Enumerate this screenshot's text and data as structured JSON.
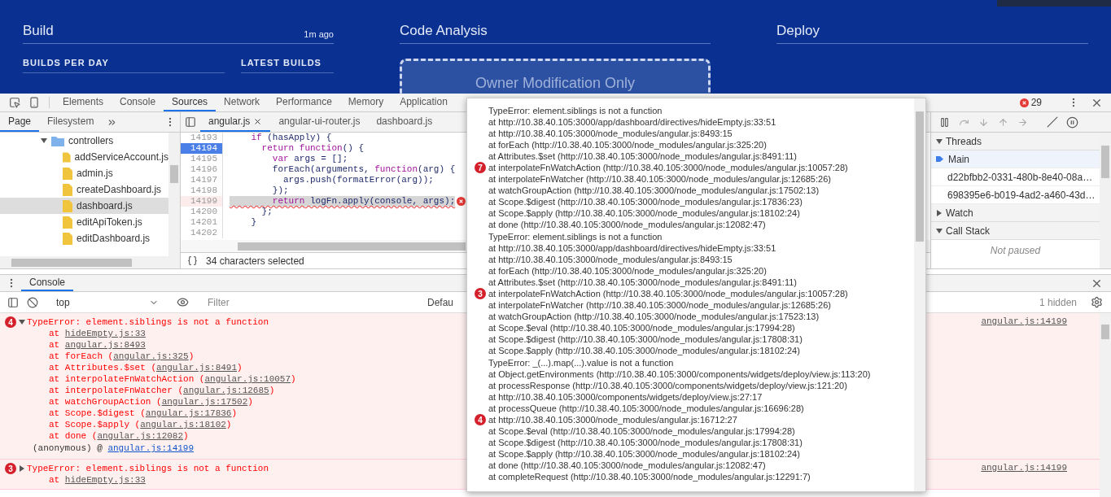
{
  "banner": {
    "sections": [
      {
        "title": "Build",
        "time": "1m ago",
        "subheaders": [
          "BUILDS PER DAY",
          "LATEST BUILDS"
        ]
      },
      {
        "title": "Code Analysis",
        "notice": "Owner Modification Only"
      },
      {
        "title": "Deploy"
      }
    ]
  },
  "devtools": {
    "tabs": [
      {
        "label": "Elements",
        "selected": false
      },
      {
        "label": "Console",
        "selected": false
      },
      {
        "label": "Sources",
        "selected": true
      },
      {
        "label": "Network",
        "selected": false
      },
      {
        "label": "Performance",
        "selected": false
      },
      {
        "label": "Memory",
        "selected": false
      },
      {
        "label": "Application",
        "selected": false
      }
    ],
    "error_count": "29",
    "navigator": {
      "tabs": [
        {
          "label": "Page",
          "selected": true
        },
        {
          "label": "Filesystem",
          "selected": false
        }
      ],
      "tree": [
        {
          "name": "controllers",
          "kind": "folder",
          "expanded": true,
          "children": [
            {
              "name": "addServiceAccount.js",
              "kind": "file",
              "selected": false
            },
            {
              "name": "admin.js",
              "kind": "file",
              "selected": false
            },
            {
              "name": "createDashboard.js",
              "kind": "file",
              "selected": false
            },
            {
              "name": "dashboard.js",
              "kind": "file",
              "selected": true
            },
            {
              "name": "editApiToken.js",
              "kind": "file",
              "selected": false
            },
            {
              "name": "editDashboard.js",
              "kind": "file",
              "selected": false
            }
          ]
        }
      ]
    },
    "editor": {
      "tabs": [
        {
          "label": "angular.js",
          "selected": true
        },
        {
          "label": "angular-ui-router.js",
          "selected": false
        },
        {
          "label": "dashboard.js",
          "selected": false
        }
      ],
      "lines": [
        {
          "number": "14193",
          "tokens": [
            {
              "keyword": true,
              "t": "    if"
            },
            {
              "keyword": false,
              "t": " (hasApply) {"
            }
          ]
        },
        {
          "number": "14194",
          "breakpoint": true,
          "tokens": [
            {
              "keyword": true,
              "t": "      return function"
            },
            {
              "keyword": false,
              "t": "() {"
            }
          ]
        },
        {
          "number": "14195",
          "tokens": [
            {
              "keyword": true,
              "t": "        var"
            },
            {
              "keyword": false,
              "t": " args = [];"
            }
          ]
        },
        {
          "number": "14196",
          "tokens": [
            {
              "keyword": false,
              "t": "        forEach(arguments, "
            },
            {
              "keyword": true,
              "t": "function"
            },
            {
              "keyword": false,
              "t": "(arg) {"
            }
          ]
        },
        {
          "number": "14197",
          "tokens": [
            {
              "keyword": false,
              "t": "          args.push(formatError(arg));"
            }
          ]
        },
        {
          "number": "14198",
          "tokens": [
            {
              "keyword": false,
              "t": "        });"
            }
          ]
        },
        {
          "number": "14199",
          "error": true,
          "selected": true,
          "tokens": [
            {
              "keyword": true,
              "t": "        return"
            },
            {
              "keyword": false,
              "t": " logFn.apply(console, args);"
            }
          ]
        },
        {
          "number": "14200",
          "tokens": [
            {
              "keyword": false,
              "t": "      };"
            }
          ]
        },
        {
          "number": "14201",
          "tokens": [
            {
              "keyword": false,
              "t": "    }"
            }
          ]
        },
        {
          "number": "14202"
        }
      ],
      "status": "34 characters selected"
    },
    "debugger": {
      "sections": [
        {
          "title": "Threads",
          "expanded": true,
          "items": [
            {
              "label": "Main",
              "selected": true
            },
            {
              "label": "d22bfbb2-0331-480b-8e40-08a…",
              "selected": false
            },
            {
              "label": "698395e6-b019-4ad2-a460-43d…",
              "selected": false
            }
          ]
        },
        {
          "title": "Watch",
          "expanded": false
        },
        {
          "title": "Call Stack",
          "expanded": true,
          "empty_text": "Not paused"
        }
      ]
    },
    "drawer": {
      "tabs": [
        {
          "label": "Console",
          "selected": true
        }
      ]
    },
    "console_toolbar": {
      "context": "top",
      "filter_placeholder": "Filter",
      "levels": "Defau",
      "hidden_count": "1 hidden"
    },
    "messages": [
      {
        "count": "4",
        "expanded": true,
        "text": "TypeError: element.siblings is not a function",
        "source": "angular.js:14199",
        "stack": [
          {
            "prefix": "at ",
            "link": "hideEmpty.js:33"
          },
          {
            "prefix": "at ",
            "link": "angular.js:8493"
          },
          {
            "prefix": "at forEach (",
            "link": "angular.js:325",
            "suffix": ")"
          },
          {
            "prefix": "at Attributes.$set (",
            "link": "angular.js:8491",
            "suffix": ")"
          },
          {
            "prefix": "at interpolateFnWatchAction (",
            "link": "angular.js:10057",
            "suffix": ")"
          },
          {
            "prefix": "at interpolateFnWatcher (",
            "link": "angular.js:12685",
            "suffix": ")"
          },
          {
            "prefix": "at watchGroupAction (",
            "link": "angular.js:17502",
            "suffix": ")"
          },
          {
            "prefix": "at Scope.$digest (",
            "link": "angular.js:17836",
            "suffix": ")"
          },
          {
            "prefix": "at Scope.$apply (",
            "link": "angular.js:18102",
            "suffix": ")"
          },
          {
            "prefix": "at done (",
            "link": "angular.js:12082",
            "suffix": ")"
          }
        ],
        "origin": {
          "prefix": "(anonymous) @ ",
          "link": "angular.js:14199"
        }
      },
      {
        "count": "3",
        "expanded": false,
        "text": "TypeError: element.siblings is not a function",
        "source": "angular.js:14199",
        "stack": [
          {
            "prefix": "at ",
            "link": "hideEmpty.js:33"
          }
        ]
      }
    ]
  },
  "tooltip": {
    "groups": [
      {
        "lines": [
          {
            "text": "TypeError: element.siblings is not a function"
          },
          {
            "text": "at http://10.38.40.105:3000/app/dashboard/directives/hideEmpty.js:33:51"
          },
          {
            "text": "at http://10.38.40.105:3000/node_modules/angular.js:8493:15"
          },
          {
            "text": "at forEach (http://10.38.40.105:3000/node_modules/angular.js:325:20)"
          },
          {
            "text": "at Attributes.$set (http://10.38.40.105:3000/node_modules/angular.js:8491:11)"
          },
          {
            "text": "at interpolateFnWatchAction (http://10.38.40.105:3000/node_modules/angular.js:10057:28)",
            "count": "7"
          },
          {
            "text": "at interpolateFnWatcher (http://10.38.40.105:3000/node_modules/angular.js:12685:26)"
          },
          {
            "text": "at watchGroupAction (http://10.38.40.105:3000/node_modules/angular.js:17502:13)"
          },
          {
            "text": "at Scope.$digest (http://10.38.40.105:3000/node_modules/angular.js:17836:23)"
          },
          {
            "text": "at Scope.$apply (http://10.38.40.105:3000/node_modules/angular.js:18102:24)"
          },
          {
            "text": "at done (http://10.38.40.105:3000/node_modules/angular.js:12082:47)"
          }
        ]
      },
      {
        "lines": [
          {
            "text": "TypeError: element.siblings is not a function"
          },
          {
            "text": "at http://10.38.40.105:3000/app/dashboard/directives/hideEmpty.js:33:51"
          },
          {
            "text": "at http://10.38.40.105:3000/node_modules/angular.js:8493:15"
          },
          {
            "text": "at forEach (http://10.38.40.105:3000/node_modules/angular.js:325:20)"
          },
          {
            "text": "at Attributes.$set (http://10.38.40.105:3000/node_modules/angular.js:8491:11)"
          },
          {
            "text": "at interpolateFnWatchAction (http://10.38.40.105:3000/node_modules/angular.js:10057:28)",
            "count": "3"
          },
          {
            "text": "at interpolateFnWatcher (http://10.38.40.105:3000/node_modules/angular.js:12685:26)"
          },
          {
            "text": "at watchGroupAction (http://10.38.40.105:3000/node_modules/angular.js:17523:13)"
          },
          {
            "text": "at Scope.$eval (http://10.38.40.105:3000/node_modules/angular.js:17994:28)"
          },
          {
            "text": "at Scope.$digest (http://10.38.40.105:3000/node_modules/angular.js:17808:31)"
          },
          {
            "text": "at Scope.$apply (http://10.38.40.105:3000/node_modules/angular.js:18102:24)"
          }
        ]
      },
      {
        "lines": [
          {
            "text": "TypeError: _(...).map(...).value is not a function"
          },
          {
            "text": "at Object.getEnvironments (http://10.38.40.105:3000/components/widgets/deploy/view.js:113:20)"
          },
          {
            "text": "at processResponse (http://10.38.40.105:3000/components/widgets/deploy/view.js:121:20)"
          },
          {
            "text": "at http://10.38.40.105:3000/components/widgets/deploy/view.js:27:17"
          },
          {
            "text": "at processQueue (http://10.38.40.105:3000/node_modules/angular.js:16696:28)"
          },
          {
            "text": "at http://10.38.40.105:3000/node_modules/angular.js:16712:27",
            "count": "4"
          },
          {
            "text": "at Scope.$eval (http://10.38.40.105:3000/node_modules/angular.js:17994:28)"
          },
          {
            "text": "at Scope.$digest (http://10.38.40.105:3000/node_modules/angular.js:17808:31)"
          },
          {
            "text": "at Scope.$apply (http://10.38.40.105:3000/node_modules/angular.js:18102:24)"
          },
          {
            "text": "at done (http://10.38.40.105:3000/node_modules/angular.js:12082:47)"
          },
          {
            "text": "at completeRequest (http://10.38.40.105:3000/node_modules/angular.js:12291:7)"
          }
        ]
      }
    ]
  }
}
